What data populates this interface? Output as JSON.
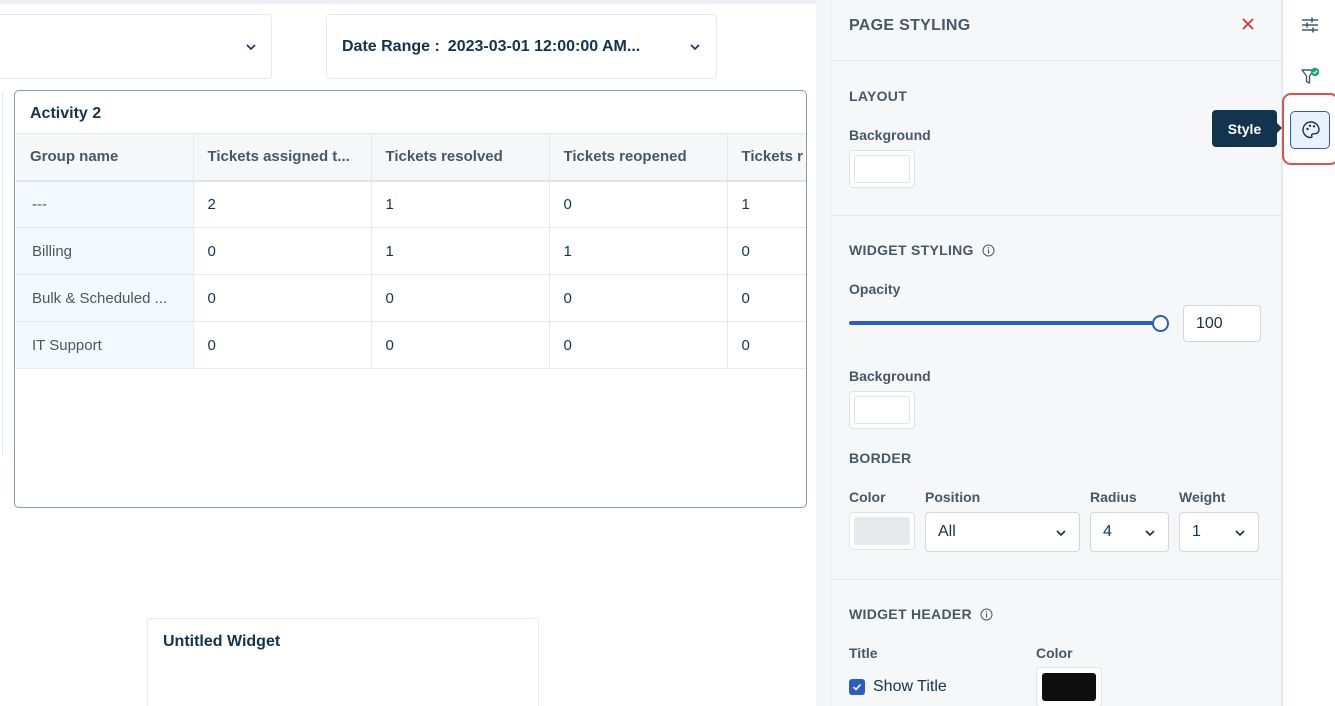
{
  "filters": {
    "filter1_value": "",
    "date_range_label": "Date Range :",
    "date_range_value": "2023-03-01 12:00:00 AM..."
  },
  "widget": {
    "title": "Activity 2",
    "columns": [
      "Group name",
      "Tickets assigned t...",
      "Tickets resolved",
      "Tickets reopened",
      "Tickets r"
    ],
    "rows": [
      [
        "---",
        "2",
        "1",
        "0",
        "1"
      ],
      [
        "Billing",
        "0",
        "1",
        "1",
        "0"
      ],
      [
        "Bulk & Scheduled ...",
        "0",
        "0",
        "0",
        "0"
      ],
      [
        "IT Support",
        "0",
        "0",
        "0",
        "0"
      ]
    ]
  },
  "widget2": {
    "title": "Untitled Widget"
  },
  "panel": {
    "title": "PAGE STYLING",
    "layout": {
      "title": "LAYOUT",
      "background_label": "Background"
    },
    "widget_styling": {
      "title": "WIDGET STYLING",
      "opacity_label": "Opacity",
      "opacity_value": "100",
      "background_label": "Background",
      "border_title": "BORDER",
      "color_label": "Color",
      "position_label": "Position",
      "position_value": "All",
      "radius_label": "Radius",
      "radius_value": "4",
      "weight_label": "Weight",
      "weight_value": "1",
      "border_color": "#e6e9ec"
    },
    "widget_header": {
      "title": "WIDGET HEADER",
      "title_label": "Title",
      "color_label": "Color",
      "show_title_label": "Show Title",
      "show_title_checked": true,
      "header_color": "#0e0e0e"
    }
  },
  "rail": {
    "tooltip": "Style",
    "icons": [
      "sliders-icon",
      "filter-check-icon",
      "palette-icon"
    ]
  },
  "colors": {
    "accent": "#2c5cc5",
    "highlight": "#d9534f",
    "text": "#12344d",
    "tooltip_bg": "#12344d"
  }
}
